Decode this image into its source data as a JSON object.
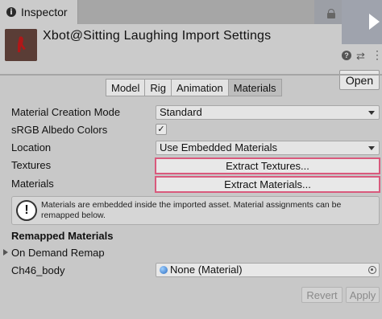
{
  "window": {
    "tab_title": "Inspector"
  },
  "header": {
    "title": "Xbot@Sitting Laughing Import Settings",
    "open_label": "Open"
  },
  "tabs": [
    {
      "label": "Model",
      "active": false
    },
    {
      "label": "Rig",
      "active": false
    },
    {
      "label": "Animation",
      "active": false
    },
    {
      "label": "Materials",
      "active": true
    }
  ],
  "properties": {
    "material_creation_mode": {
      "label": "Material Creation Mode",
      "value": "Standard"
    },
    "srgb_albedo": {
      "label": "sRGB Albedo Colors",
      "checked": "✓"
    },
    "location": {
      "label": "Location",
      "value": "Use Embedded Materials"
    },
    "textures": {
      "label": "Textures",
      "button": "Extract Textures..."
    },
    "materials": {
      "label": "Materials",
      "button": "Extract Materials..."
    }
  },
  "info": {
    "icon": "!",
    "text": "Materials are embedded inside the imported asset. Material assignments can be remapped below."
  },
  "remapped": {
    "title": "Remapped Materials",
    "foldout": "On Demand Remap",
    "item": {
      "label": "Ch46_body",
      "value": "None (Material)"
    }
  },
  "footer": {
    "revert": "Revert",
    "apply": "Apply"
  },
  "colors": {
    "highlight_border": "#d95a7d",
    "panel_bg": "#c8c8c8"
  }
}
